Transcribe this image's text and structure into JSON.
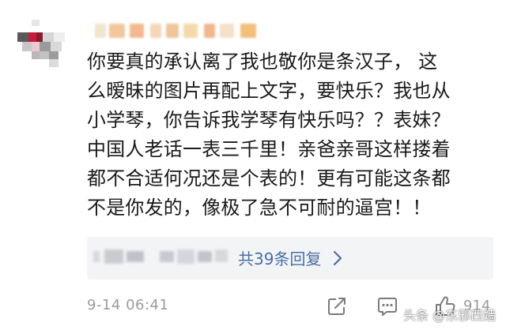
{
  "comment": {
    "lines": [
      "你要真的承认离了我也敬你是条汉子，  这",
      "么暧昧的图片再配上文字，要快乐？我也从",
      "小学琴，你告诉我学琴有快乐吗？？表妹？",
      "中国人老话一表三千里！亲爸亲哥这样搂着",
      "都不合适何况还是个表的！更有可能这条都",
      "不是你发的，像极了急不可耐的逼宫！！"
    ]
  },
  "replies": {
    "link_text": "共39条回复",
    "link_color": "#4a6fa5"
  },
  "footer": {
    "timestamp": "9-14 06:41",
    "like_count": "914"
  },
  "watermark": "头条 @东邪西嫱",
  "icons": {
    "avatar": "avatar",
    "share": "share-icon",
    "comment": "comment-icon",
    "like": "thumbs-up-icon",
    "chevron": "chevron-right-icon"
  },
  "colors": {
    "text": "#1a1a1a",
    "muted": "#9b9b9b",
    "link": "#4a6fa5",
    "reply_bg": "#f3f4f6"
  }
}
